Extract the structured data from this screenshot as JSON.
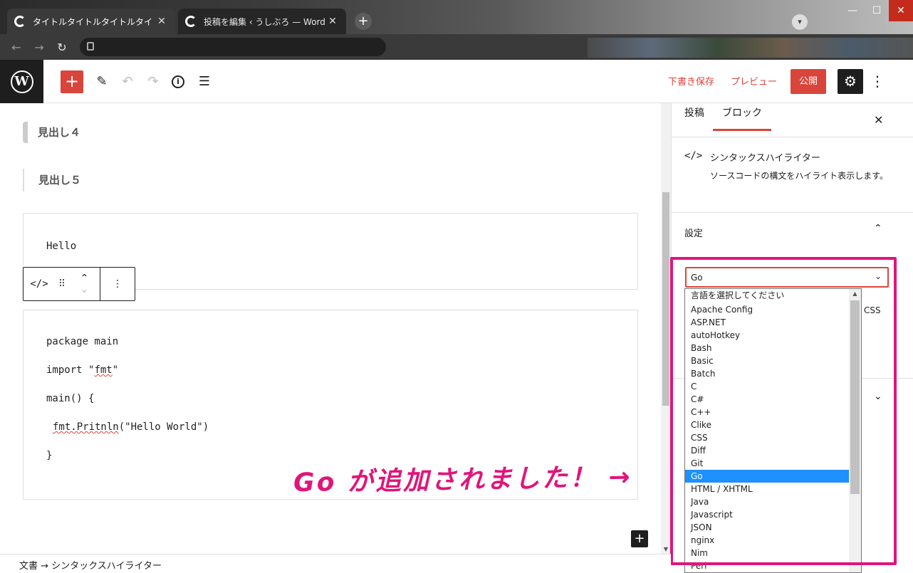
{
  "browser": {
    "tabs": [
      {
        "title": "タイトルタイトルタイトルタイトル – うし",
        "active": true
      },
      {
        "title": "投稿を編集 ‹ うしぶろ — WordPress",
        "active": false
      }
    ],
    "new_tab": "+",
    "window_controls": [
      "—",
      "☐",
      "✕"
    ]
  },
  "toolbar": {
    "logo": "W",
    "inserter": "+",
    "save_draft": "下書き保存",
    "preview": "プレビュー",
    "publish": "公開",
    "settings": "⚙",
    "more": "⋮"
  },
  "editor": {
    "heading4": "見出し４",
    "heading5": "見出し５",
    "code1": "Hello",
    "code2": {
      "l1": "package main",
      "l2a": "import \"",
      "l2b": "fmt",
      "l2c": "\"",
      "l3": "main() {",
      "l4a": "fmt.Pritnln",
      "l4b": "(\"Hello World\")",
      "l5": "}"
    },
    "block_toolbar": {
      "type_icon": "</>",
      "drag": "⠿",
      "move_up": "⌃",
      "move_down": "⌄",
      "more": "⋮"
    },
    "add_block": "+"
  },
  "annotation": "Go が追加されました！ →",
  "sidebar": {
    "tabs": [
      "投稿",
      "ブロック"
    ],
    "close": "✕",
    "block_icon": "</>",
    "block_title": "シンタックスハイライター",
    "block_desc": "ソースコードの構文をハイライト表示します。",
    "settings_label": "設定",
    "chevron_up": "⌃",
    "chevron_down": "⌄",
    "css_fragment": "CSS"
  },
  "lang_select": {
    "value": "Go",
    "arrow": "⌄",
    "options": [
      "言語を選択してください",
      "Apache Config",
      "ASP.NET",
      "autoHotkey",
      "Bash",
      "Basic",
      "Batch",
      "C",
      "C#",
      "C++",
      "Clike",
      "CSS",
      "Diff",
      "Git",
      "Go",
      "HTML / XHTML",
      "Java",
      "Javascript",
      "JSON",
      "nginx",
      "Nim",
      "Perl"
    ],
    "selected": "Go"
  },
  "footer": {
    "breadcrumb": "文書 → シンタックスハイライター"
  }
}
